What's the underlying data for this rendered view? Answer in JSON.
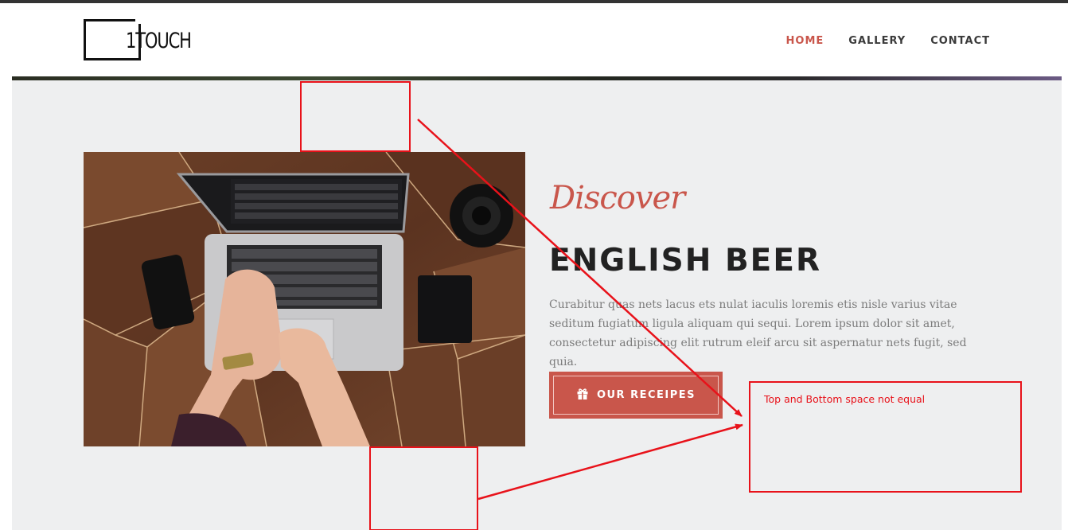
{
  "header": {
    "logo_text": "1TOUCH",
    "nav": [
      {
        "label": "HOME",
        "active": true
      },
      {
        "label": "GALLERY",
        "active": false
      },
      {
        "label": "CONTACT",
        "active": false
      }
    ]
  },
  "hero": {
    "script_title": "Discover",
    "title": "ENGLISH BEER",
    "description": "Curabitur quas nets lacus ets nulat iaculis loremis etis nisle varius vitae seditum fugiatum ligula aliquam qui sequi. Lorem ipsum dolor sit amet, consectetur adipiscing elit rutrum eleif arcu sit aspernatur nets fugit, sed quia.",
    "cta_label": "OUR RECEIPES",
    "cta_icon": "gift-icon",
    "image_alt": "laptop-on-wooden-desk"
  },
  "annotation": {
    "note": "Top and Bottom space not equal"
  },
  "colors": {
    "accent": "#c9564b",
    "section_bg": "#eeeff0",
    "annotation": "#e8121a"
  }
}
